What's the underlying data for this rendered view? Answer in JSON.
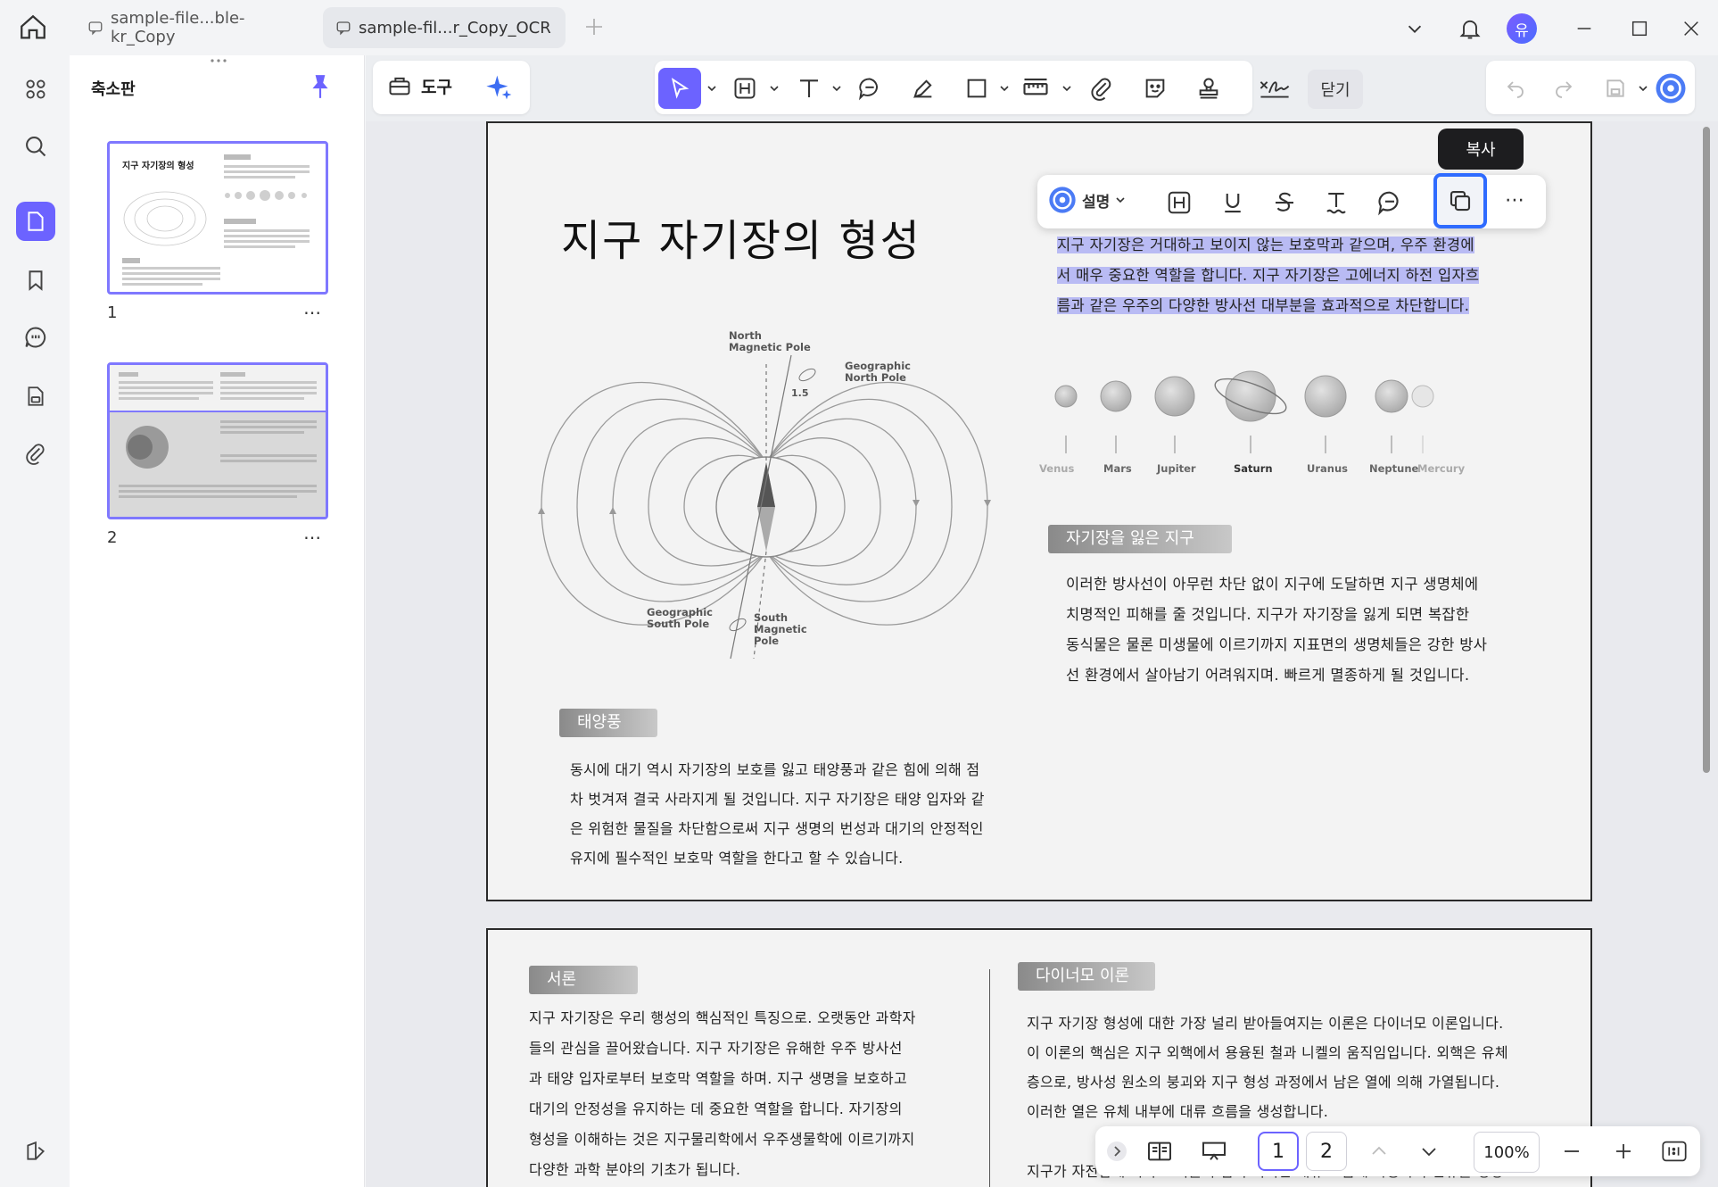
{
  "tabs": [
    {
      "label": "sample-file...ble-kr_Copy",
      "active": false
    },
    {
      "label": "sample-fil...r_Copy_OCR",
      "active": true
    }
  ],
  "user_avatar": "유",
  "thumbnail_panel": {
    "title": "축소판",
    "pages": [
      {
        "number": "1",
        "mini_title": "지구 자기장의 형성"
      },
      {
        "number": "2"
      }
    ]
  },
  "toolbar": {
    "tools_label": "도구",
    "close_label": "닫기"
  },
  "floating_toolbar": {
    "ai_label": "설명",
    "copy_tooltip": "복사"
  },
  "page1": {
    "title": "지구 자기장의 형성",
    "highlighted_text": [
      "지구 자기장은 거대하고 보이지 않는 보호막과 같으며, 우주 환경에",
      "서 매우 중요한 역할을 합니다. 지구 자기장은 고에너지 하전 입자흐",
      "름과 같은 우주의 다양한 방사선 대부분을 효과적으로 차단합니다."
    ],
    "diagram_labels": {
      "north_magnetic_pole": [
        "North",
        "Magnetic Pole"
      ],
      "geographic_north_pole": [
        "Geographic",
        "North Pole"
      ],
      "angle": "1.5",
      "geographic_south_pole": [
        "Geographic",
        "South Pole"
      ],
      "south_magnetic_pole": [
        "South",
        "Magnetic",
        "Pole"
      ]
    },
    "planets": [
      "Venus",
      "Mars",
      "Jupiter",
      "Saturn",
      "Uranus",
      "Neptune",
      "Mercury"
    ],
    "section_lost": {
      "tag": "자기장을 잃은 지구",
      "lines": [
        "이러한 방사선이 아무런 차단 없이 지구에 도달하면 지구 생명체에",
        "치명적인 피해를 줄 것입니다. 지구가 자기장을 잃게 되면 복잡한",
        "동식물은 물론 미생물에 이르기까지 지표면의 생명체들은 강한 방사",
        "선 환경에서 살아남기 어려워지며. 빠르게 멸종하게 될 것입니다."
      ]
    },
    "section_solar_wind": {
      "tag": "태양풍",
      "lines": [
        "동시에 대기 역시 자기장의 보호를 잃고 태양풍과 같은 힘에 의해 점",
        "차 벗겨져 결국 사라지게 될 것입니다. 지구 자기장은 태양 입자와 같",
        "은 위험한 물질을 차단함으로써 지구 생명의 번성과 대기의 안정적인",
        "유지에 필수적인 보호막 역할을 한다고 할 수 있습니다."
      ]
    }
  },
  "page2": {
    "section_intro": {
      "tag": "서론",
      "lines": [
        "지구 자기장은 우리 행성의 핵심적인 특징으로. 오랫동안 과학자",
        "들의 관심을 끌어왔습니다. 지구 자기장은 유해한 우주 방사선",
        "과 태양 입자로부터 보호막 역할을 하며. 지구 생명을 보호하고",
        "대기의 안정성을 유지하는 데 중요한 역할을 합니다. 자기장의",
        "형성을 이해하는 것은 지구물리학에서 우주생물학에 이르기까지",
        "다양한 과학 분야의 기초가 됩니다."
      ]
    },
    "section_dynamo": {
      "tag": "다이너모 이론",
      "lines": [
        "지구 자기장 형성에 대한 가장 널리 받아들여지는 이론은 다이너모 이론입니다.",
        "이 이론의 핵심은 지구 외핵에서 용융된 철과 니켈의 움직임입니다. 외핵은 유체",
        "층으로, 방사성 원소의 붕괴와 지구 형성 과정에서 남은 열에 의해 가열됩니다.",
        "이러한 열은 유체 내부에 대류 흐름을 생성합니다.",
        "지구가 자전함에 따라 코리올리 힘이 이러한 대류 흐름에 작용하여 전류를 생성"
      ]
    }
  },
  "bottom_bar": {
    "current_page": "1",
    "page_2": "2",
    "zoom": "100%"
  },
  "colors": {
    "accent": "#6c63ff",
    "highlight": "#b9bbf4",
    "copy_border": "#2f6bff"
  }
}
